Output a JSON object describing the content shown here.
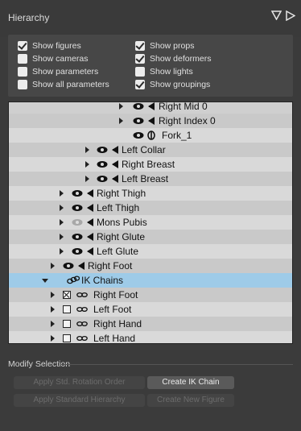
{
  "panel": {
    "title": "Hierarchy"
  },
  "options": {
    "show_figures": "Show figures",
    "show_props": "Show props",
    "show_cameras": "Show cameras",
    "show_deformers": "Show deformers",
    "show_parameters": "Show parameters",
    "show_lights": "Show lights",
    "show_all_parameters": "Show all parameters",
    "show_groupings": "Show groupings",
    "checked": {
      "show_figures": true,
      "show_props": true,
      "show_cameras": false,
      "show_deformers": true,
      "show_parameters": false,
      "show_lights": false,
      "show_all_parameters": false,
      "show_groupings": true
    }
  },
  "tree": {
    "rows": [
      {
        "label": "Right Mid 0"
      },
      {
        "label": "Right Index 0"
      },
      {
        "label": "Fork_1"
      },
      {
        "label": "Left Collar"
      },
      {
        "label": "Right Breast"
      },
      {
        "label": "Left Breast"
      },
      {
        "label": "Right Thigh"
      },
      {
        "label": "Left Thigh"
      },
      {
        "label": "Mons Pubis"
      },
      {
        "label": "Right Glute"
      },
      {
        "label": "Left Glute"
      },
      {
        "label": "Right Foot"
      },
      {
        "label": "IK Chains"
      },
      {
        "label": "Right Foot"
      },
      {
        "label": "Left Foot"
      },
      {
        "label": "Right Hand"
      },
      {
        "label": "Left Hand"
      }
    ]
  },
  "modify": {
    "title": "Modify Selection",
    "apply_rotation_order": "Apply Std. Rotation Order",
    "create_ik_chain": "Create IK Chain",
    "apply_standard_hierarchy": "Apply Standard Hierarchy",
    "create_new_figure": "Create New Figure"
  },
  "icons": {
    "collapse_panel": "triangle-down-icon",
    "expand_panel": "triangle-right-icon",
    "visibility": "eye-icon",
    "bone": "bone-icon",
    "ik_chain": "ik-chain-icon"
  }
}
